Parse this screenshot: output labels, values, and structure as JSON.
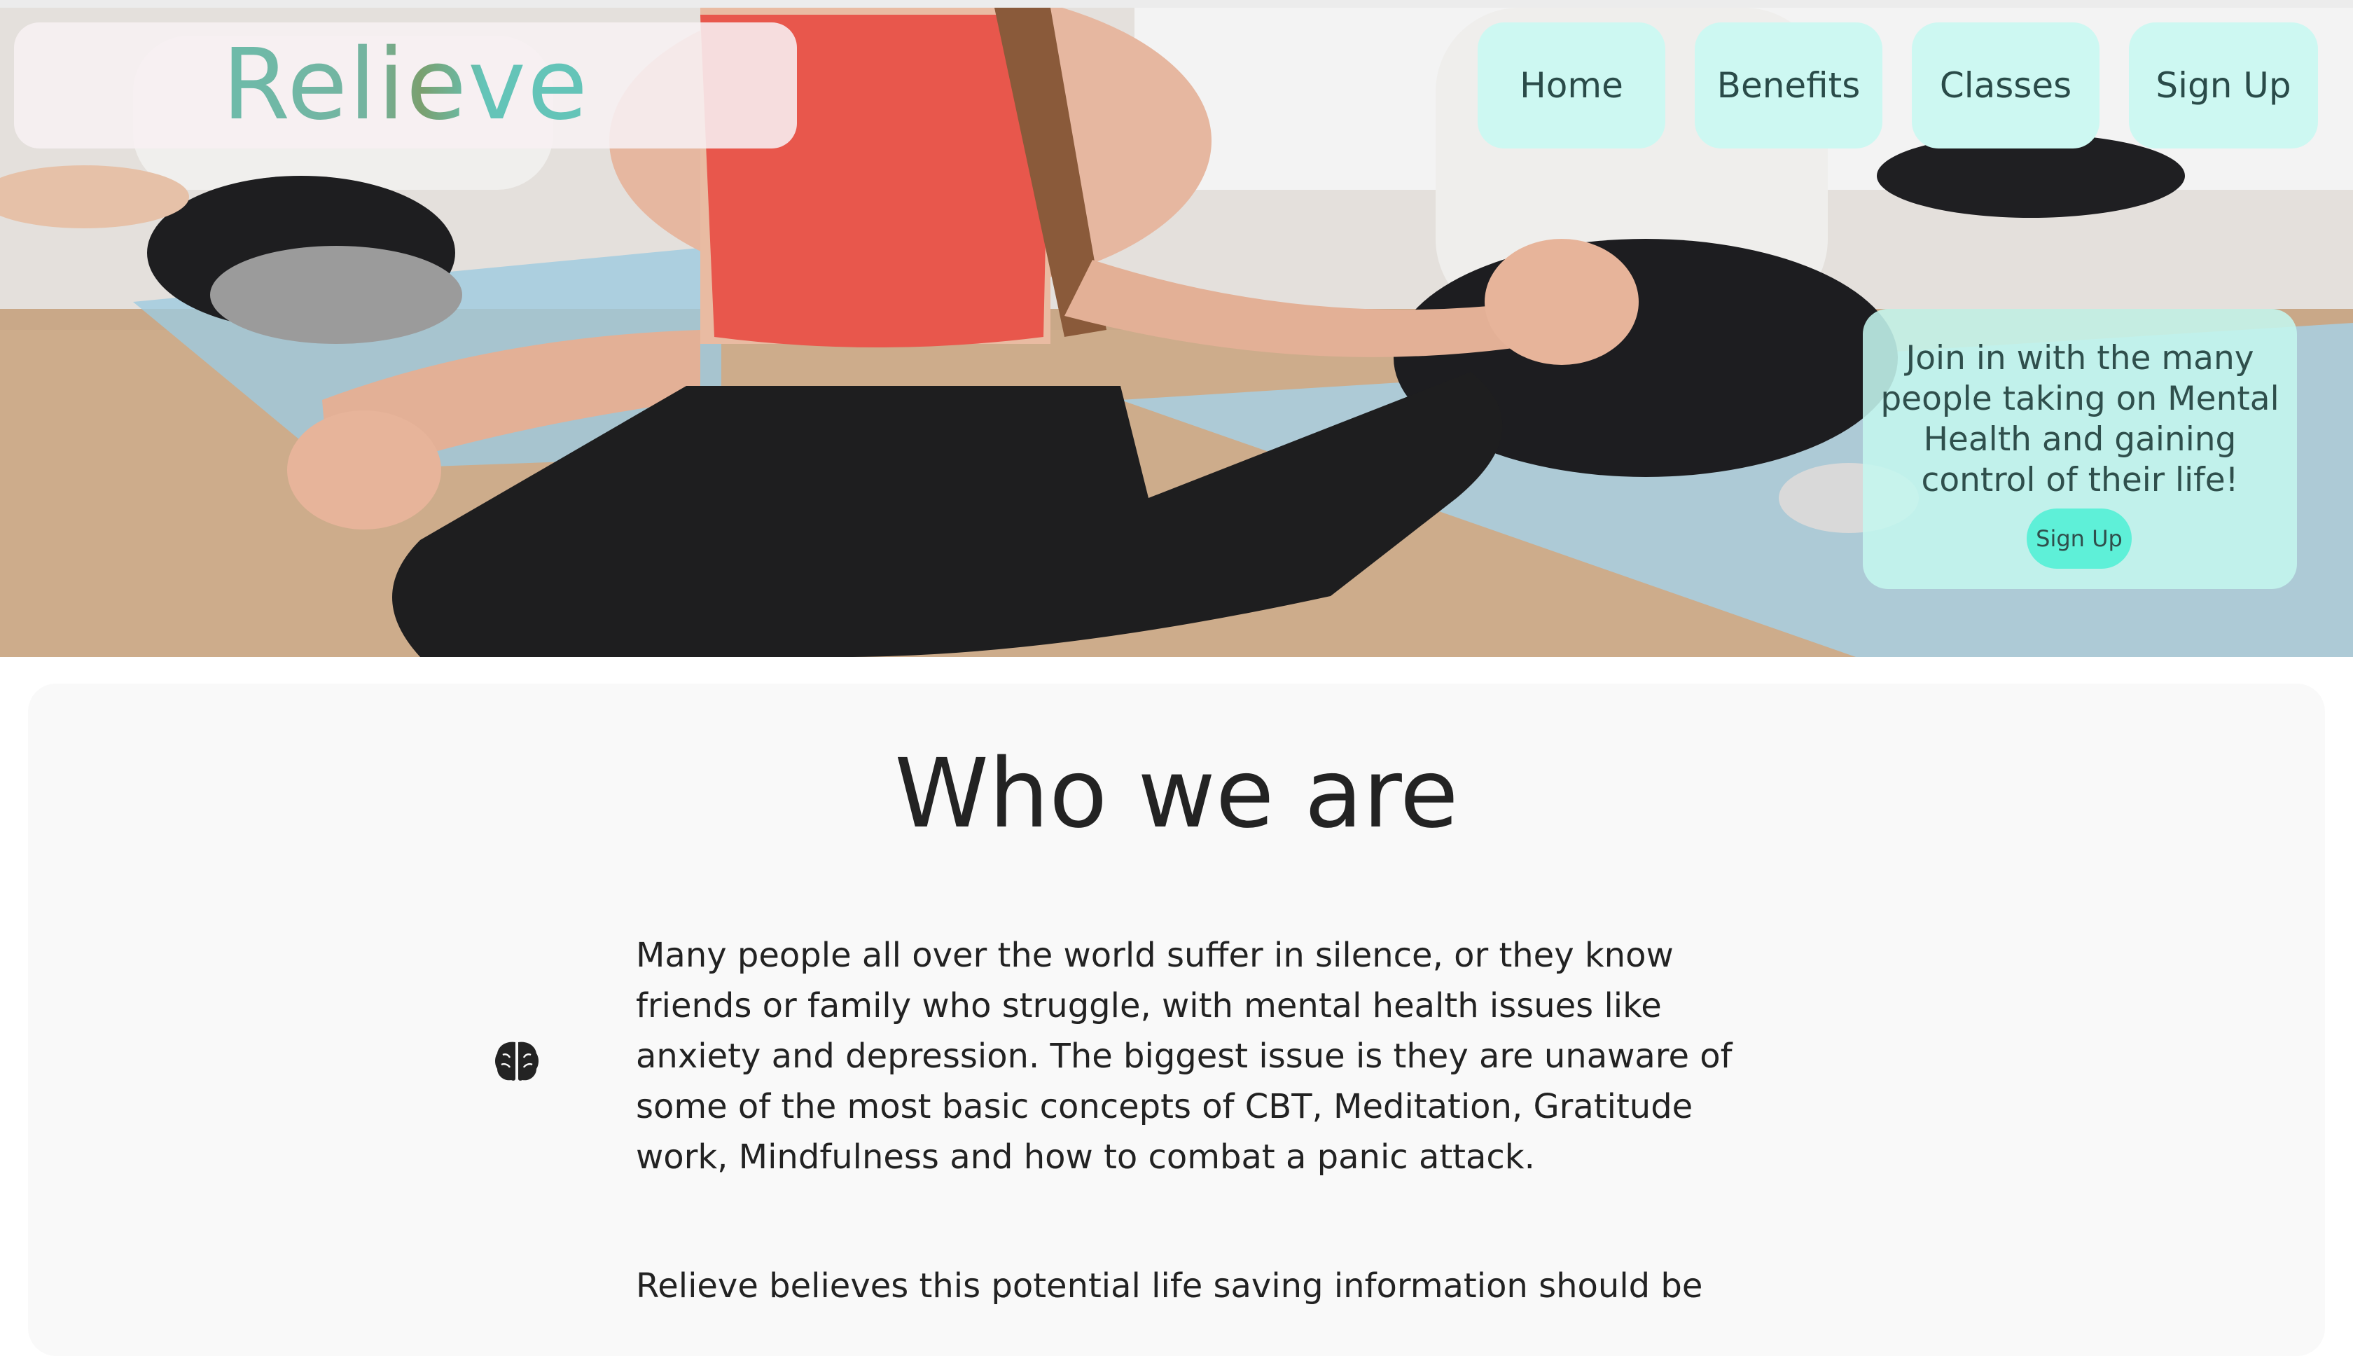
{
  "brand": {
    "name": "Relieve"
  },
  "nav": {
    "items": [
      {
        "label": "Home"
      },
      {
        "label": "Benefits"
      },
      {
        "label": "Classes"
      },
      {
        "label": "Sign Up"
      }
    ]
  },
  "hero": {
    "image_description": "yoga-class-meditation-photo",
    "join_card": {
      "text": "Join in with the many people taking on Mental Health and gaining control of their life!",
      "button_label": "Sign Up"
    }
  },
  "about": {
    "title": "Who we are",
    "icon": "brain-icon",
    "paragraphs": [
      "Many people all over the world suffer in silence, or they know friends or family who struggle, with mental health issues like anxiety and depression. The biggest issue is they are unaware of some of the most basic concepts of CBT, Meditation, Gratitude work, Mindfulness and how to combat a panic attack.",
      "Relieve believes this potential life saving information should be"
    ]
  },
  "colors": {
    "nav_button_bg": "#cdf8f2",
    "card_bg": "#c4f6ee",
    "accent": "#5ef0d8",
    "text_dark": "#2a4b49"
  }
}
